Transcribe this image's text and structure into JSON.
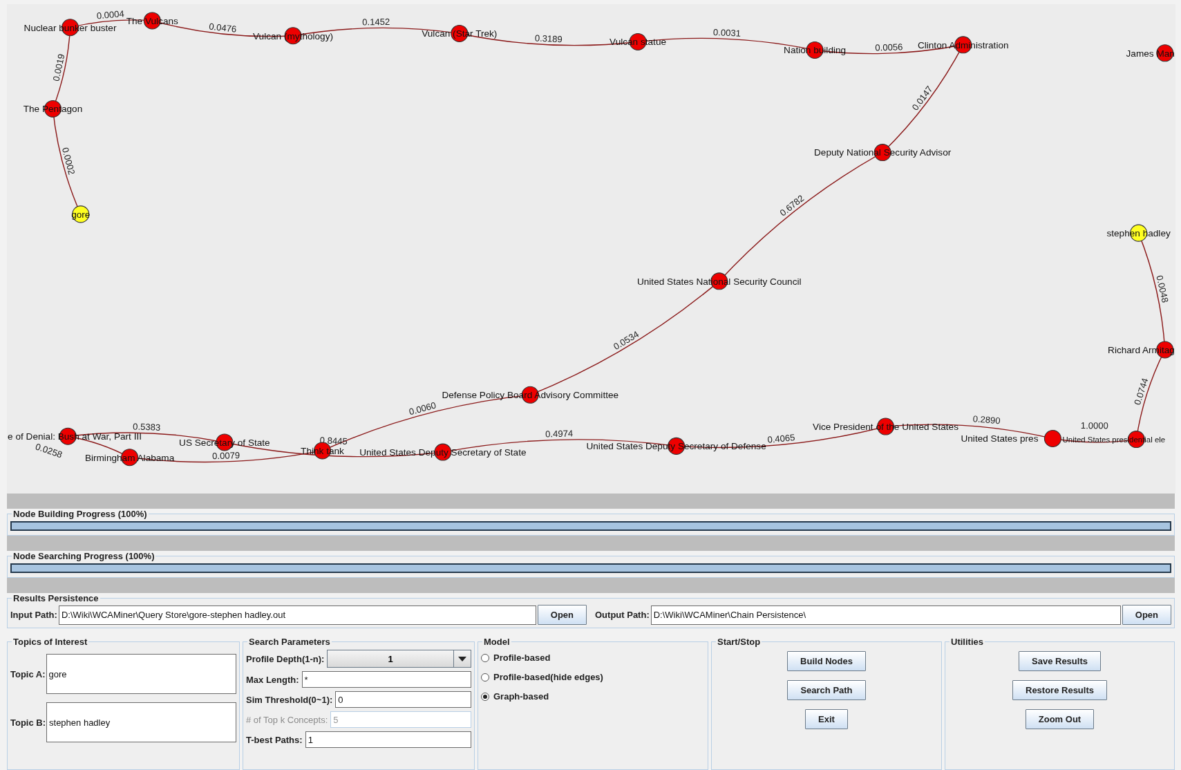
{
  "graph": {
    "nodes": [
      {
        "label": "Nuclear bunker buster",
        "kind": "concept"
      },
      {
        "label": "The Vulcans",
        "kind": "concept"
      },
      {
        "label": "Vulcan (mythology)",
        "kind": "concept"
      },
      {
        "label": "Vulcan (Star Trek)",
        "kind": "concept"
      },
      {
        "label": "Vulcan statue",
        "kind": "concept"
      },
      {
        "label": "Nation building",
        "kind": "concept"
      },
      {
        "label": "Clinton Administration",
        "kind": "concept"
      },
      {
        "label": "James Man",
        "kind": "concept"
      },
      {
        "label": "The Pentagon",
        "kind": "concept"
      },
      {
        "label": "gore",
        "kind": "endpoint"
      },
      {
        "label": "Deputy National Security Advisor",
        "kind": "concept"
      },
      {
        "label": "stephen hadley",
        "kind": "endpoint"
      },
      {
        "label": "United States National Security Council",
        "kind": "concept"
      },
      {
        "label": "Richard Armitag",
        "kind": "concept"
      },
      {
        "label": "Defense Policy Board Advisory Committee",
        "kind": "concept"
      },
      {
        "label": "e of Denial: Bush at War, Part III",
        "kind": "concept"
      },
      {
        "label": "US Secretary of State",
        "kind": "concept"
      },
      {
        "label": "Birmingham Alabama",
        "kind": "concept"
      },
      {
        "label": "Think tank",
        "kind": "concept"
      },
      {
        "label": "United States Deputy Secretary of State",
        "kind": "concept"
      },
      {
        "label": "United States Deputy Secretary of Defense",
        "kind": "concept"
      },
      {
        "label": "Vice President of the United States",
        "kind": "concept"
      },
      {
        "label": "United States pres",
        "kind": "concept"
      },
      {
        "label": "United States presidential ele",
        "kind": "concept"
      }
    ],
    "edges": [
      {
        "weight": "0.0002"
      },
      {
        "weight": "0.0019"
      },
      {
        "weight": "0.0004"
      },
      {
        "weight": "0.0476"
      },
      {
        "weight": "0.1452"
      },
      {
        "weight": "0.3189"
      },
      {
        "weight": "0.0031"
      },
      {
        "weight": "0.0056"
      },
      {
        "weight": "0.0147"
      },
      {
        "weight": "0.6782"
      },
      {
        "weight": "0.0534"
      },
      {
        "weight": "0.0060"
      },
      {
        "weight": "0.0079"
      },
      {
        "weight": "0.0258"
      },
      {
        "weight": "0.5383"
      },
      {
        "weight": "0.8445"
      },
      {
        "weight": "0.4974"
      },
      {
        "weight": "0.4065"
      },
      {
        "weight": "0.2890"
      },
      {
        "weight": "1.0000"
      },
      {
        "weight": "0.0744"
      },
      {
        "weight": "0.0048"
      }
    ]
  },
  "progress": [
    {
      "title": "Node Building Progress (100%)",
      "level": 1
    },
    {
      "title": "Node Searching Progress (100%)",
      "level": 1
    }
  ],
  "persistence": {
    "title": "Results Persistence",
    "paths": [
      {
        "label": "Input Path:",
        "value": "D:\\Wiki\\WCAMiner\\Query Store\\gore-stephen hadley.out",
        "button": "Open"
      },
      {
        "label": "Output Path:",
        "value": "D:\\Wiki\\WCAMiner\\Chain Persistence\\",
        "button": "Open"
      }
    ]
  },
  "topics": {
    "title": "Topics of Interest",
    "fields": [
      {
        "label": "Topic A:",
        "value": "gore"
      },
      {
        "label": "Topic B:",
        "value": "stephen hadley"
      }
    ]
  },
  "search": {
    "title": "Search Parameters",
    "fields": [
      {
        "label": "Profile Depth(1-n):",
        "value": "1",
        "kind": "combo",
        "disabled": false
      },
      {
        "label": "Max Length:",
        "value": "*",
        "kind": "text",
        "disabled": false
      },
      {
        "label": "Sim Threshold(0~1):",
        "value": "0",
        "kind": "text",
        "disabled": false
      },
      {
        "label": "# of Top k Concepts:",
        "value": "5",
        "kind": "text",
        "disabled": true
      },
      {
        "label": "T-best Paths:",
        "value": "1",
        "kind": "text",
        "disabled": false
      }
    ]
  },
  "model": {
    "title": "Model",
    "options": [
      {
        "label": "Profile-based",
        "selected": false
      },
      {
        "label": "Profile-based(hide edges)",
        "selected": false
      },
      {
        "label": "Graph-based",
        "selected": true
      }
    ]
  },
  "start_stop": {
    "title": "Start/Stop",
    "buttons": [
      "Build Nodes",
      "Search Path",
      "Exit"
    ]
  },
  "utilities": {
    "title": "Utilities",
    "buttons": [
      "Save Results",
      "Restore Results",
      "Zoom Out"
    ]
  }
}
